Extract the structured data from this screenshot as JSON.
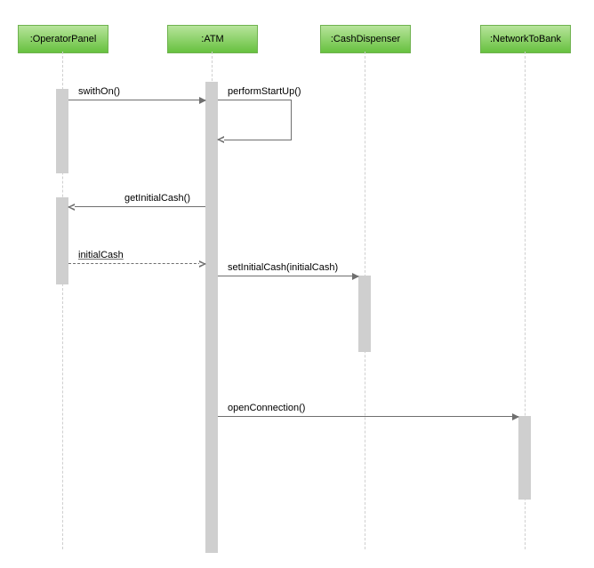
{
  "lifelines": {
    "operator": ":OperatorPanel",
    "atm": ":ATM",
    "dispenser": ":CashDispenser",
    "network": ":NetworkToBank"
  },
  "messages": {
    "switchOn": "swithOn()",
    "performStartUp": "performStartUp()",
    "getInitialCash": "getInitialCash()",
    "initialCashReturn": "initialCash",
    "setInitialCash": "setInitialCash(initialCash)",
    "openConnection": "openConnection()"
  },
  "chart_data": {
    "type": "sequence-diagram",
    "lifelines": [
      ":OperatorPanel",
      ":ATM",
      ":CashDispenser",
      ":NetworkToBank"
    ],
    "messages": [
      {
        "from": ":OperatorPanel",
        "to": ":ATM",
        "label": "swithOn()",
        "type": "sync"
      },
      {
        "from": ":ATM",
        "to": ":ATM",
        "label": "performStartUp()",
        "type": "self"
      },
      {
        "from": ":ATM",
        "to": ":OperatorPanel",
        "label": "getInitialCash()",
        "type": "sync"
      },
      {
        "from": ":OperatorPanel",
        "to": ":ATM",
        "label": "initialCash",
        "type": "return"
      },
      {
        "from": ":ATM",
        "to": ":CashDispenser",
        "label": "setInitialCash(initialCash)",
        "type": "sync"
      },
      {
        "from": ":ATM",
        "to": ":NetworkToBank",
        "label": "openConnection()",
        "type": "sync"
      }
    ]
  }
}
